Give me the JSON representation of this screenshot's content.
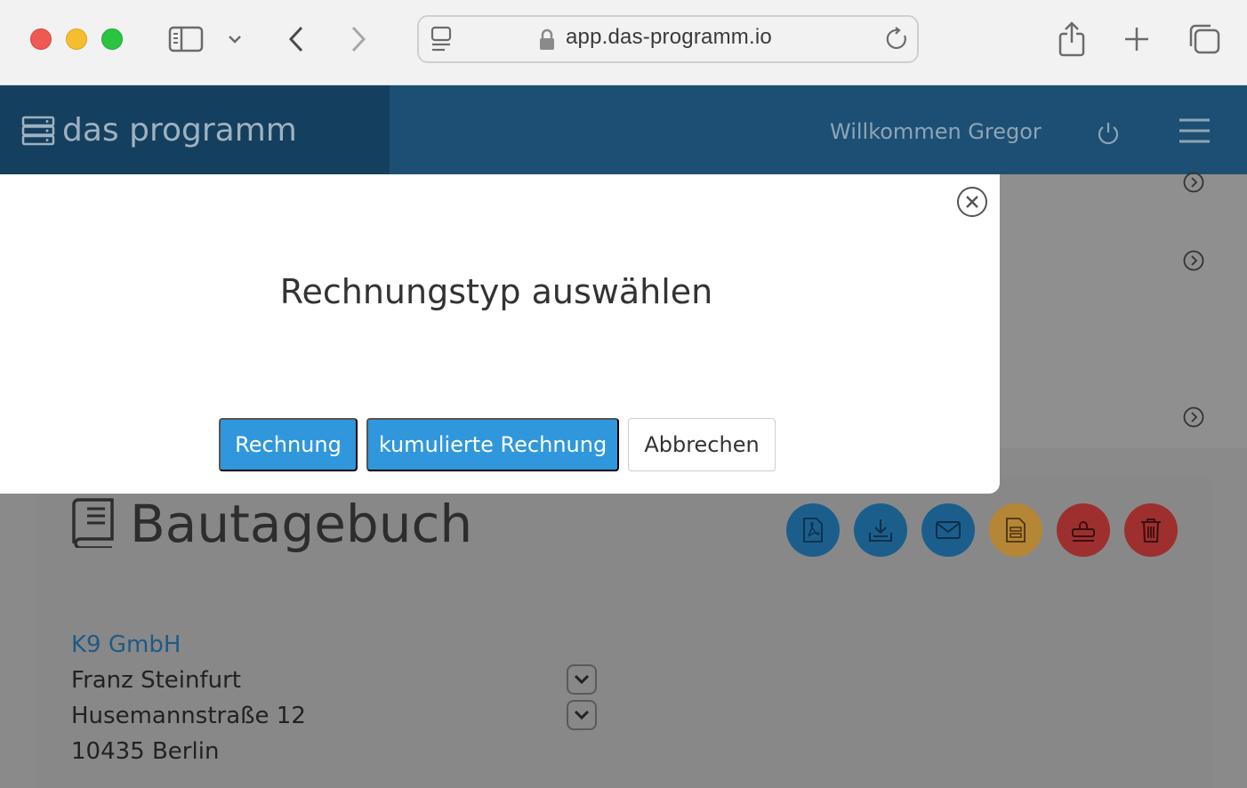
{
  "browser": {
    "url": "app.das-programm.io"
  },
  "header": {
    "brand": "das programm",
    "welcome": "Willkommen Gregor"
  },
  "modal": {
    "title": "Rechnungstyp auswählen",
    "buttons": {
      "invoice": "Rechnung",
      "cumulative": "kumulierte Rechnung",
      "cancel": "Abbrechen"
    }
  },
  "page": {
    "title": "Bautagebuch",
    "company": "K9 GmbH",
    "contact": "Franz Steinfurt",
    "street": "Husemannstraße 12",
    "city": "10435 Berlin"
  },
  "actions": [
    {
      "icon": "pdf-icon",
      "color": "#1b5e8c"
    },
    {
      "icon": "download-icon",
      "color": "#1b5e8c"
    },
    {
      "icon": "mail-icon",
      "color": "#1b5e8c"
    },
    {
      "icon": "document-icon",
      "color": "#b58635"
    },
    {
      "icon": "stamp-icon",
      "color": "#9e2f2f"
    },
    {
      "icon": "trash-icon",
      "color": "#9e2f2f"
    }
  ]
}
